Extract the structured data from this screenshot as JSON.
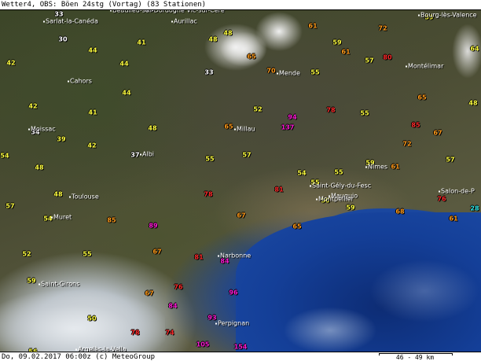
{
  "header": {
    "title": "Wetter4, OBS: Böen 24stg (Vortag) (83 Stationen)"
  },
  "footer": {
    "datestamp": "Do, 09.02.2017 06:00z (c) MeteoGroup",
    "scale_label": "46 - 49 km"
  },
  "colors": {
    "yellow": "#ffff40",
    "white": "#ffffff",
    "orange": "#ff9a1a",
    "red": "#ff2a2a",
    "magenta": "#ff1ad6",
    "cyan": "#33e6e6",
    "sea": "#16429a",
    "snow": "#e8ecef"
  },
  "cities": [
    {
      "id": "beaulieu",
      "name": "Beaulieu-sur-Dordogne Vic-sur-Cère"
    },
    {
      "id": "aurillac",
      "name": "Aurillac"
    },
    {
      "id": "sarlat",
      "name": "Sarlat-la-Canéda"
    },
    {
      "id": "bourg",
      "name": "Bourg-lès-Valence"
    },
    {
      "id": "mende",
      "name": "Mende"
    },
    {
      "id": "montelimar",
      "name": "Montélimar"
    },
    {
      "id": "cahors",
      "name": "Cahors"
    },
    {
      "id": "moissac",
      "name": "Moissac"
    },
    {
      "id": "millau",
      "name": "Millau"
    },
    {
      "id": "albi",
      "name": "Albi"
    },
    {
      "id": "nimes",
      "name": "Nîmes"
    },
    {
      "id": "toulouse",
      "name": "Toulouse"
    },
    {
      "id": "stgely",
      "name": "Saint-Gély-du-Fesc"
    },
    {
      "id": "mauguio",
      "name": "Mauguio"
    },
    {
      "id": "montpellier",
      "name": "Montpellier"
    },
    {
      "id": "salon",
      "name": "Salon-de-P"
    },
    {
      "id": "muret",
      "name": "Muret"
    },
    {
      "id": "narbonne",
      "name": "Narbonne"
    },
    {
      "id": "stgirons",
      "name": "Saint-Girons"
    },
    {
      "id": "perpignan",
      "name": "Perpignan"
    },
    {
      "id": "argeles",
      "name": "Argelès-la-Vella"
    }
  ],
  "observations": [
    {
      "value": "33",
      "color": "white"
    },
    {
      "value": "36",
      "color": "white"
    },
    {
      "value": "30",
      "color": "white"
    },
    {
      "value": "41",
      "color": "yellow"
    },
    {
      "value": "48",
      "color": "yellow"
    },
    {
      "value": "48",
      "color": "yellow"
    },
    {
      "value": "61",
      "color": "orange"
    },
    {
      "value": "59",
      "color": "yellow"
    },
    {
      "value": "72",
      "color": "orange"
    },
    {
      "value": "59",
      "color": "yellow"
    },
    {
      "value": "42",
      "color": "yellow"
    },
    {
      "value": "44",
      "color": "yellow"
    },
    {
      "value": "44",
      "color": "yellow"
    },
    {
      "value": "65",
      "color": "orange"
    },
    {
      "value": "61",
      "color": "orange"
    },
    {
      "value": "57",
      "color": "yellow"
    },
    {
      "value": "80",
      "color": "red"
    },
    {
      "value": "64",
      "color": "yellow"
    },
    {
      "value": "33",
      "color": "white"
    },
    {
      "value": "70",
      "color": "orange"
    },
    {
      "value": "55",
      "color": "yellow"
    },
    {
      "value": "44",
      "color": "yellow"
    },
    {
      "value": "65",
      "color": "orange"
    },
    {
      "value": "48",
      "color": "yellow"
    },
    {
      "value": "42",
      "color": "yellow"
    },
    {
      "value": "41",
      "color": "yellow"
    },
    {
      "value": "52",
      "color": "yellow"
    },
    {
      "value": "94",
      "color": "magenta"
    },
    {
      "value": "78",
      "color": "red"
    },
    {
      "value": "55",
      "color": "yellow"
    },
    {
      "value": "39",
      "color": "yellow"
    },
    {
      "value": "48",
      "color": "yellow"
    },
    {
      "value": "65",
      "color": "orange"
    },
    {
      "value": "137",
      "color": "magenta"
    },
    {
      "value": "85",
      "color": "red"
    },
    {
      "value": "67",
      "color": "orange"
    },
    {
      "value": "34",
      "color": "white"
    },
    {
      "value": "42",
      "color": "yellow"
    },
    {
      "value": "72",
      "color": "orange"
    },
    {
      "value": "54",
      "color": "yellow"
    },
    {
      "value": "37",
      "color": "white"
    },
    {
      "value": "55",
      "color": "yellow"
    },
    {
      "value": "57",
      "color": "yellow"
    },
    {
      "value": "59",
      "color": "yellow"
    },
    {
      "value": "57",
      "color": "yellow"
    },
    {
      "value": "48",
      "color": "yellow"
    },
    {
      "value": "54",
      "color": "yellow"
    },
    {
      "value": "55",
      "color": "yellow"
    },
    {
      "value": "61",
      "color": "orange"
    },
    {
      "value": "55",
      "color": "yellow"
    },
    {
      "value": "78",
      "color": "red"
    },
    {
      "value": "81",
      "color": "red"
    },
    {
      "value": "48",
      "color": "yellow"
    },
    {
      "value": "50",
      "color": "yellow"
    },
    {
      "value": "59",
      "color": "yellow"
    },
    {
      "value": "76",
      "color": "red"
    },
    {
      "value": "57",
      "color": "yellow"
    },
    {
      "value": "54",
      "color": "yellow"
    },
    {
      "value": "85",
      "color": "orange"
    },
    {
      "value": "67",
      "color": "orange"
    },
    {
      "value": "68",
      "color": "orange"
    },
    {
      "value": "28",
      "color": "cyan"
    },
    {
      "value": "89",
      "color": "magenta"
    },
    {
      "value": "65",
      "color": "orange"
    },
    {
      "value": "61",
      "color": "orange"
    },
    {
      "value": "52",
      "color": "yellow"
    },
    {
      "value": "55",
      "color": "yellow"
    },
    {
      "value": "67",
      "color": "orange"
    },
    {
      "value": "81",
      "color": "red"
    },
    {
      "value": "84",
      "color": "magenta"
    },
    {
      "value": "59",
      "color": "yellow"
    },
    {
      "value": "76",
      "color": "red"
    },
    {
      "value": "96",
      "color": "magenta"
    },
    {
      "value": "67",
      "color": "orange"
    },
    {
      "value": "84",
      "color": "magenta"
    },
    {
      "value": "50",
      "color": "yellow"
    },
    {
      "value": "93",
      "color": "magenta"
    },
    {
      "value": "78",
      "color": "red"
    },
    {
      "value": "74",
      "color": "red"
    },
    {
      "value": "105",
      "color": "magenta"
    },
    {
      "value": "154",
      "color": "magenta"
    },
    {
      "value": "56",
      "color": "yellow"
    }
  ]
}
